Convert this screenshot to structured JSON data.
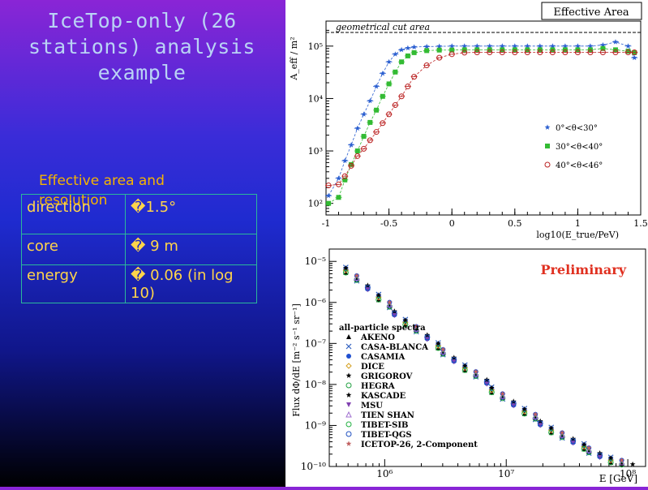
{
  "slide": {
    "title_lines": [
      "IceTop-only (26",
      "stations) analysis",
      "example"
    ],
    "resolution_heading": "Effective area and resolution",
    "resolution_table": [
      {
        "label": "direction",
        "value": "�1.5°"
      },
      {
        "label": "core",
        "value": "� 9 m"
      },
      {
        "label": "energy",
        "value": "� 0.06 (in log 10)"
      }
    ]
  },
  "chart_data": [
    {
      "type": "line",
      "title": "Effective Area",
      "xlabel": "log10(E_true/PeV)",
      "ylabel": "A_eff / m²",
      "xlim": [
        -1,
        1.5
      ],
      "ylim": [
        60,
        300000
      ],
      "yscale": "log",
      "x_ticks": [
        "-1",
        "-0.5",
        "0",
        "0.5",
        "1",
        "1.5"
      ],
      "y_ticks": [
        "10²",
        "10³",
        "10⁴",
        "10⁵"
      ],
      "annotation": "geometrical cut area",
      "legend": "right",
      "series": [
        {
          "name": "0°<θ<30°",
          "color": "#2b5fd0",
          "marker": "star",
          "x": [
            -0.98,
            -0.9,
            -0.85,
            -0.8,
            -0.75,
            -0.7,
            -0.65,
            -0.6,
            -0.55,
            -0.5,
            -0.45,
            -0.4,
            -0.35,
            -0.3,
            -0.2,
            -0.1,
            0,
            0.1,
            0.2,
            0.3,
            0.4,
            0.5,
            0.6,
            0.7,
            0.8,
            0.9,
            1.0,
            1.1,
            1.2,
            1.3,
            1.4,
            1.45
          ],
          "y": [
            140,
            300,
            650,
            1300,
            2700,
            5000,
            9000,
            17000,
            30000,
            50000,
            70000,
            85000,
            92000,
            96000,
            98000,
            99000,
            100000,
            100000,
            100000,
            100000,
            100000,
            100000,
            100000,
            100000,
            100000,
            100000,
            100000,
            100000,
            105000,
            120000,
            100000,
            60000
          ]
        },
        {
          "name": "30°<θ<40°",
          "color": "#33bb33",
          "marker": "square",
          "x": [
            -0.98,
            -0.9,
            -0.85,
            -0.8,
            -0.75,
            -0.7,
            -0.65,
            -0.6,
            -0.55,
            -0.5,
            -0.45,
            -0.4,
            -0.35,
            -0.3,
            -0.2,
            -0.1,
            0,
            0.1,
            0.2,
            0.3,
            0.4,
            0.5,
            0.6,
            0.7,
            0.8,
            0.9,
            1.0,
            1.1,
            1.2,
            1.3,
            1.4,
            1.45
          ],
          "y": [
            100,
            130,
            280,
            550,
            1000,
            1900,
            3500,
            6000,
            11000,
            19000,
            32000,
            50000,
            65000,
            75000,
            82000,
            84000,
            84000,
            85000,
            85000,
            85000,
            85000,
            85000,
            85000,
            85000,
            85000,
            85000,
            85000,
            85000,
            90000,
            85000,
            80000,
            75000
          ]
        },
        {
          "name": "40°<θ<46°",
          "color": "#bb2222",
          "marker": "open-circle",
          "x": [
            -0.98,
            -0.9,
            -0.85,
            -0.8,
            -0.75,
            -0.7,
            -0.65,
            -0.6,
            -0.55,
            -0.5,
            -0.45,
            -0.4,
            -0.35,
            -0.3,
            -0.2,
            -0.1,
            0,
            0.1,
            0.2,
            0.3,
            0.4,
            0.5,
            0.6,
            0.7,
            0.8,
            0.9,
            1.0,
            1.1,
            1.2,
            1.3,
            1.4,
            1.45
          ],
          "y": [
            220,
            230,
            330,
            520,
            800,
            1100,
            1600,
            2300,
            3400,
            5000,
            7500,
            11000,
            17000,
            26000,
            43000,
            60000,
            70000,
            75000,
            76000,
            76000,
            76000,
            76000,
            76000,
            76000,
            76000,
            76000,
            76000,
            76000,
            76000,
            76000,
            76000,
            76000
          ]
        }
      ]
    },
    {
      "type": "scatter",
      "title": "",
      "badge": "Preliminary",
      "xlabel": "E [GeV]",
      "ylabel": "Flux dΦ/dE [m⁻² s⁻¹ sr⁻¹]",
      "xscale": "log",
      "yscale": "log",
      "xlim": [
        350000,
        140000000
      ],
      "ylim": [
        1e-10,
        2e-05
      ],
      "x_ticks": [
        "10⁶",
        "10⁷",
        "10⁸"
      ],
      "y_ticks": [
        "10⁻⁵",
        "10⁻⁶",
        "10⁻⁷",
        "10⁻⁸",
        "10⁻⁹",
        "10⁻¹⁰"
      ],
      "legend_title": "all-particle spectra",
      "legend": "left",
      "series": [
        {
          "name": "AKENO",
          "color": "#000000",
          "marker": "triangle"
        },
        {
          "name": "CASA-BLANCA",
          "color": "#3060c0",
          "marker": "cross"
        },
        {
          "name": "CASAMIA",
          "color": "#2050d0",
          "marker": "circle"
        },
        {
          "name": "DICE",
          "color": "#d4a020",
          "marker": "diamond"
        },
        {
          "name": "GRIGOROV",
          "color": "#000000",
          "marker": "star"
        },
        {
          "name": "HEGRA",
          "color": "#20a040",
          "marker": "open-circle"
        },
        {
          "name": "KASCADE",
          "color": "#000000",
          "marker": "star"
        },
        {
          "name": "MSU",
          "color": "#8040b0",
          "marker": "down-triangle"
        },
        {
          "name": "TIEN SHAN",
          "color": "#a070d0",
          "marker": "open-triangle"
        },
        {
          "name": "TIBET-SIB",
          "color": "#20b040",
          "marker": "open-circle"
        },
        {
          "name": "TIBET-QGS",
          "color": "#2050c0",
          "marker": "open-circle"
        },
        {
          "name": "ICETOP-26, 2-Component",
          "color": "#c06060",
          "marker": "star"
        }
      ],
      "spectrum_points": {
        "log10_E": [
          5.7,
          5.78,
          5.86,
          5.94,
          6.02,
          6.1,
          6.18,
          6.26,
          6.34,
          6.42,
          6.5,
          6.58,
          6.66,
          6.74,
          6.82,
          6.9,
          6.98,
          7.06,
          7.14,
          7.22,
          7.3,
          7.38,
          7.46,
          7.54,
          7.62,
          7.7,
          7.78,
          7.86,
          7.94,
          8.02,
          8.1
        ],
        "log10_flux": [
          -5.2,
          -5.42,
          -5.64,
          -5.86,
          -6.07,
          -6.27,
          -6.47,
          -6.66,
          -6.85,
          -7.04,
          -7.22,
          -7.4,
          -7.58,
          -7.76,
          -7.94,
          -8.12,
          -8.3,
          -8.47,
          -8.64,
          -8.8,
          -8.95,
          -9.1,
          -9.25,
          -9.38,
          -9.5,
          -9.62,
          -9.73,
          -9.83,
          -9.92,
          -10.0,
          -10.08
        ]
      }
    }
  ]
}
